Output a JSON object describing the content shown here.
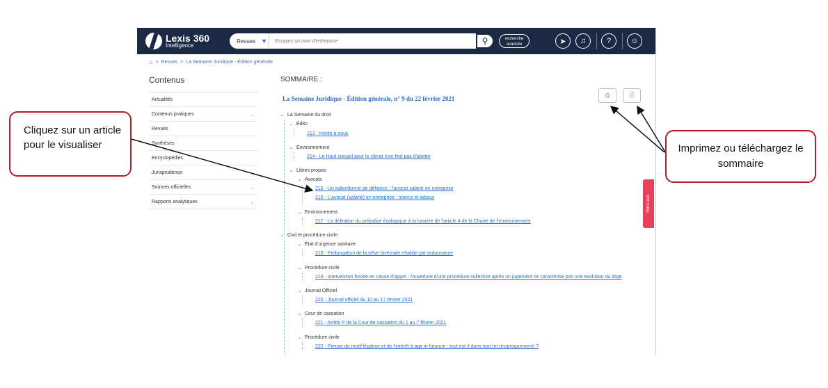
{
  "header": {
    "logo_name": "Lexis 360",
    "logo_sub": "Intelligence",
    "search_scope": "Revues",
    "search_placeholder": "Essayez un nom d'entreprise",
    "advanced_search_label": "recherche\navancée"
  },
  "breadcrumb": [
    "Revues",
    "La Semaine Juridique - Édition générale"
  ],
  "sidebar": {
    "title": "Contenus",
    "items": [
      {
        "label": "Actualités",
        "expandable": false
      },
      {
        "label": "Contenus pratiques",
        "expandable": true
      },
      {
        "label": "Revues",
        "expandable": false
      },
      {
        "label": "Synthèses",
        "expandable": false
      },
      {
        "label": "Encyclopédies",
        "expandable": false
      },
      {
        "label": "Jurisprudence",
        "expandable": true
      },
      {
        "label": "Sources officielles",
        "expandable": true
      },
      {
        "label": "Rapports analytiques",
        "expandable": true
      }
    ]
  },
  "main": {
    "heading": "SOMMAIRE :",
    "issue_title": "La Semaine Juridique - Édition générale, n° 9 du 22 février 2021",
    "tree": {
      "n1": "La Semaine du droit",
      "n1a": "Édito",
      "l213": "213 - Honte à nous",
      "n1b": "Environnement",
      "l214": "214 - Le Haut conseil pour le climat n'en finit pas d'alerter",
      "n1c": "Libres propos",
      "n1c1": "Avocats",
      "l215": "215 - Un subordonné de défiance : l'avocat salarié en entreprise",
      "l216": "216 - L'avocat (salarié) en entreprise : totems et tabous",
      "n1c2": "Environnement",
      "l217": "217 - La définition du préjudice écologique à la lumière de l'article 4 de la Charte de l'environnement",
      "n2": "Civil et procédure civile",
      "n2a": "État d'urgence sanitaire",
      "l218": "218 - Prolongation de la trêve hivernale rétablie par ordonnance",
      "n2b": "Procédure civile",
      "l219": "219 - Intervention forcée en cause d'appel : l'ouverture d'une procédure collective après un jugement ne caractérise pas une évolution du litige",
      "n2c": "Journal Officiel",
      "l220": "220 - Journal officiel du 10 au 17 février 2021",
      "n2d": "Cour de cassation",
      "l221": "221 - Arrêts P de la Cour de cassation du 1 au 7 février 2021",
      "n2e": "Procédure civile",
      "l222": "222 - Preuve du motif légitime et de l'intérêt à agir in futurum : tout est-il dans tout (et réciproquement) ?"
    }
  },
  "feedback_tab": "Votre avis",
  "callouts": {
    "left": "Cliquez sur un article pour le visualiser",
    "right": "Imprimez ou téléchargez le sommaire"
  },
  "colors": {
    "topbar": "#1b2a44",
    "link": "#2b6cc4",
    "callout_border": "#b01c24",
    "feedback": "#e8405a"
  }
}
